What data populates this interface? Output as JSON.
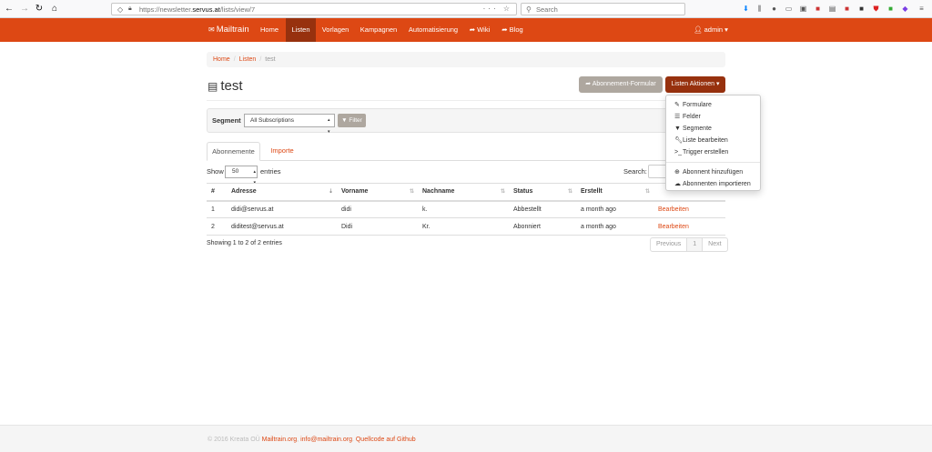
{
  "browser": {
    "url_prefix": "https://newsletter.",
    "url_domain": "servus.at",
    "url_path": "/lists/view/7",
    "search_placeholder": "Search",
    "actions": "··· ☆"
  },
  "app": {
    "brand": "Mailtrain",
    "nav": [
      "Home",
      "Listen",
      "Vorlagen",
      "Kampagnen",
      "Automatisierung",
      "Wiki",
      "Blog"
    ],
    "active_nav": "Listen",
    "user": "admin",
    "accent": "#dd4814",
    "accent_dark": "#97310e"
  },
  "breadcrumb": {
    "home": "Home",
    "lists": "Listen",
    "current": "test"
  },
  "page": {
    "title": "test",
    "subscription_form_button": "Abonnement-Formular",
    "list_actions_button": "Listen Aktionen"
  },
  "segment": {
    "label": "Segment",
    "selected": "All Subscriptions",
    "filter_button": "Filter"
  },
  "tabs": {
    "subscriptions": "Abonnemente",
    "imports": "Importe"
  },
  "table_controls": {
    "show": "Show",
    "page_length": "50",
    "entries": "entries",
    "search": "Search:"
  },
  "table": {
    "columns": [
      "#",
      "Adresse",
      "Vorname",
      "Nachname",
      "Status",
      "Erstellt",
      ""
    ],
    "rows": [
      [
        "1",
        "didi@servus.at",
        "didi",
        "k.",
        "Abbestellt",
        "a month ago",
        "Bearbeiten"
      ],
      [
        "2",
        "diditest@servus.at",
        "Didi",
        "Kr.",
        "Abonniert",
        "a month ago",
        "Bearbeiten"
      ]
    ],
    "info": "Showing 1 to 2 of 2 entries",
    "pager": {
      "previous": "Previous",
      "page": "1",
      "next": "Next"
    }
  },
  "dropdown": {
    "items": [
      {
        "label": "Formulare",
        "icon": "pencil-icon"
      },
      {
        "label": "Felder",
        "icon": "list-icon"
      },
      {
        "label": "Segmente",
        "icon": "filter-icon"
      },
      {
        "label": "Liste bearbeiten",
        "icon": "wrench-icon"
      },
      {
        "label": "Trigger erstellen",
        "icon": "console-icon"
      },
      {
        "label": "Abonnent hinzufügen",
        "icon": "plus-circle-icon"
      },
      {
        "label": "Abonnenten importieren",
        "icon": "upload-cloud-icon"
      }
    ]
  },
  "footer": {
    "copyright": "© 2016 Kreata OÜ",
    "link1": "Mailtrain.org",
    "link2": "info@mailtrain.org",
    "link3": "Quellcode auf Github"
  }
}
